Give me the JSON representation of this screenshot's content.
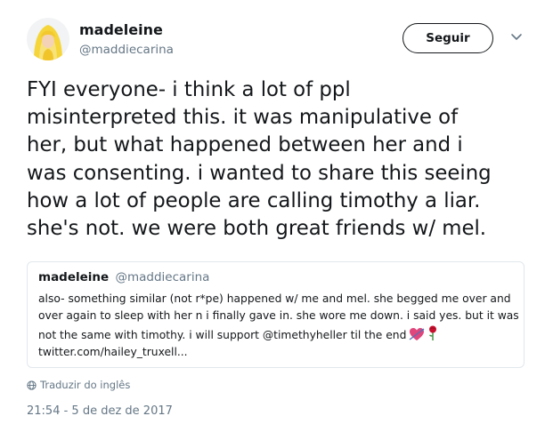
{
  "author": {
    "display_name": "madeleine",
    "handle": "@maddiecarina",
    "avatar_icon": "avatar-photo"
  },
  "actions": {
    "follow_label": "Seguir",
    "menu_icon": "chevron-down-icon"
  },
  "tweet": {
    "lines": [
      "FYI everyone- i think a lot of ppl",
      "misinterpreted this. it was manipulative of",
      "her, but what happened between her and i",
      "was consenting. i wanted to share this seeing",
      "how a lot of people are calling timothy a liar.",
      "she's not. we were both great friends w/ mel."
    ]
  },
  "quoted_tweet": {
    "display_name": "madeleine",
    "handle": "@maddiecarina",
    "lines": [
      "also- something similar (not r*pe) happened w/ me and mel. she begged me over and",
      "over again to sleep with her n i finally gave in. she wore me down. i said yes. but it was",
      "not the same with timothy. i will support @timethyheller til the end",
      "twitter.com/hailey_truxell..."
    ],
    "emojis": [
      "heart-with-arrow-icon",
      "rose-icon"
    ]
  },
  "translate": {
    "label": "Traduzir do inglês",
    "icon": "globe-icon"
  },
  "timestamp": "21:54 - 5 de dez de 2017",
  "colors": {
    "text": "#14171a",
    "secondary": "#657786",
    "border": "#e1e8ed",
    "avatar_yellow": "#f5d53a"
  }
}
